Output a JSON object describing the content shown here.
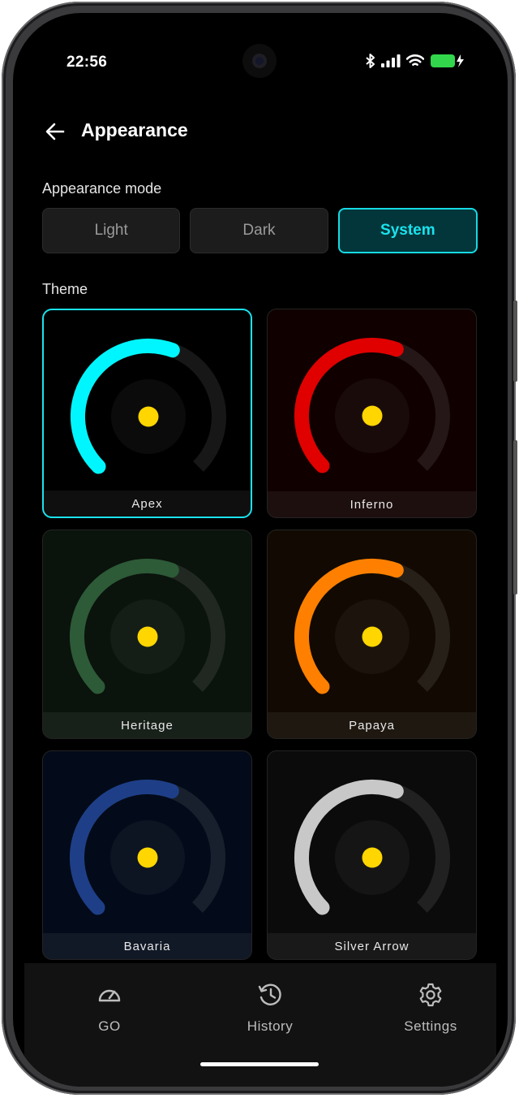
{
  "status_bar": {
    "time": "22:56"
  },
  "header": {
    "title": "Appearance"
  },
  "appearance_mode": {
    "label": "Appearance mode",
    "options": [
      "Light",
      "Dark",
      "System"
    ],
    "selected": "System"
  },
  "theme": {
    "label": "Theme",
    "selected": "Apex",
    "items": [
      {
        "name": "Apex",
        "accent": "#00f6ff",
        "bg": "#000000"
      },
      {
        "name": "Inferno",
        "accent": "#e00000",
        "bg": "#100000"
      },
      {
        "name": "Heritage",
        "accent": "#2d5a37",
        "bg": "#0a130c"
      },
      {
        "name": "Papaya",
        "accent": "#ff8000",
        "bg": "#120a02"
      },
      {
        "name": "Bavaria",
        "accent": "#1e3f87",
        "bg": "#030a19"
      },
      {
        "name": "Silver Arrow",
        "accent": "#c8c8c8",
        "bg": "#0b0b0b"
      }
    ]
  },
  "tabbar": {
    "items": [
      {
        "label": "GO",
        "icon": "speedometer-icon"
      },
      {
        "label": "History",
        "icon": "history-icon"
      },
      {
        "label": "Settings",
        "icon": "gear-icon"
      }
    ]
  },
  "colors": {
    "dot": "#ffd600",
    "selection": "#19e3ee"
  }
}
